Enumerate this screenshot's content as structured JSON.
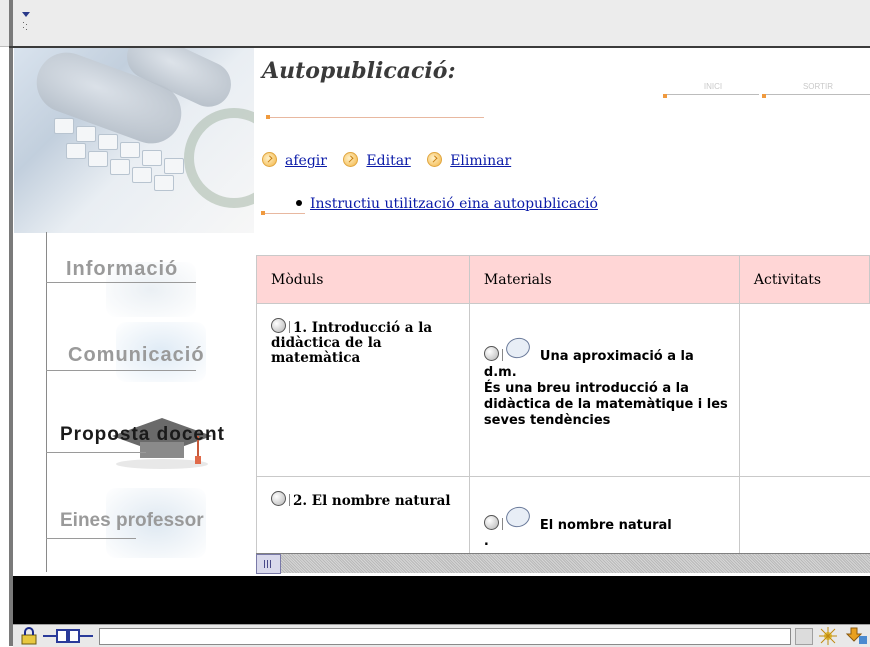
{
  "title": "Autopublicació:",
  "header_tabs": [
    "INICI",
    "SORTIR"
  ],
  "actions": [
    {
      "label": "afegir"
    },
    {
      "label": "Editar"
    },
    {
      "label": "Eliminar"
    }
  ],
  "instructions_link": "Instructiu utilització eina autopublicació",
  "nav": {
    "items": [
      {
        "label": "Informació",
        "active": false
      },
      {
        "label": "Comunicació",
        "active": false
      },
      {
        "label": "Proposta docent",
        "active": true
      },
      {
        "label": "Eines professor",
        "active": false
      }
    ]
  },
  "table": {
    "headers": [
      "Mòduls",
      "Materials",
      "Activitats"
    ],
    "rows": [
      {
        "module": "1. Introducció a la didàctica de la matemàtica",
        "material_title": "Una aproximació a la d.m.",
        "material_desc": "És una breu introducció a la didàctica de la matemàtique i les seves tendències"
      },
      {
        "module": "2. El nombre natural",
        "material_title": "El nombre natural",
        "material_desc": "."
      }
    ]
  },
  "colors": {
    "header_bg": "#ffd6d6",
    "link": "#0a1aa8",
    "accent_orange": "#f09a3e"
  }
}
